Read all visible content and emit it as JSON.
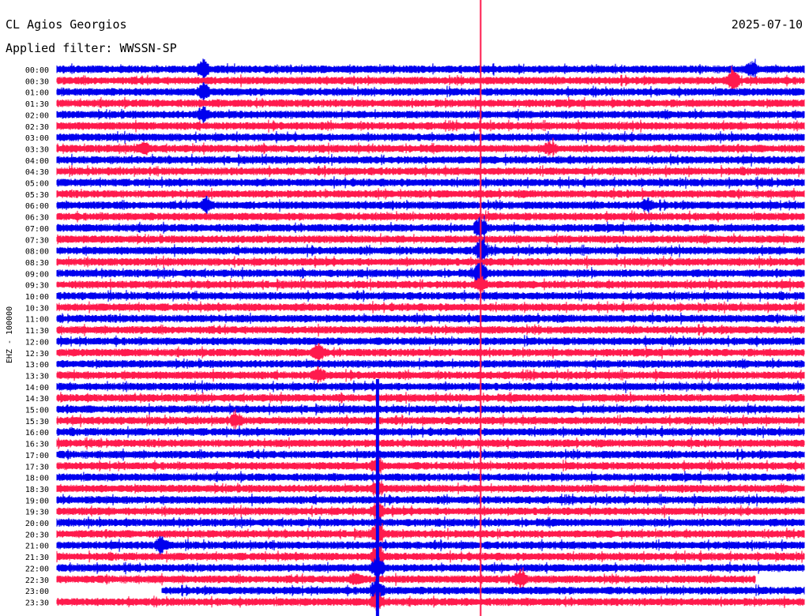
{
  "header": {
    "station": "CL Agios Georgios",
    "date": "2025-07-10",
    "filter": "Applied filter: WWSSN-SP"
  },
  "chart_data": {
    "type": "line",
    "title": "CL Agios Georgios",
    "ylabel": "EHZ - 100000",
    "row_labels": [
      "00:00",
      "00:30",
      "01:00",
      "01:30",
      "02:00",
      "02:30",
      "03:00",
      "03:30",
      "04:00",
      "04:30",
      "05:00",
      "05:30",
      "06:00",
      "06:30",
      "07:00",
      "07:30",
      "08:00",
      "08:30",
      "09:00",
      "09:30",
      "10:00",
      "10:30",
      "11:00",
      "11:30",
      "12:00",
      "12:30",
      "13:00",
      "13:30",
      "14:00",
      "14:30",
      "15:00",
      "15:30",
      "16:00",
      "16:30",
      "17:00",
      "17:30",
      "18:00",
      "18:30",
      "19:00",
      "19:30",
      "20:00",
      "20:30",
      "21:00",
      "21:30",
      "22:00",
      "22:30",
      "23:00",
      "23:30"
    ],
    "colors": [
      "#0000ee",
      "#ff1a4d"
    ],
    "event_lines": [
      {
        "color": "#ff1a4d",
        "x_fraction": 0.567
      },
      {
        "color": "#0000ee",
        "x_fraction": 0.429
      }
    ],
    "events": [
      {
        "row": 0,
        "pos": 0.196,
        "amp": 1.8,
        "color": "#0000ee"
      },
      {
        "row": 0,
        "pos": 0.93,
        "amp": 1.2,
        "color": "#0000ee"
      },
      {
        "row": 1,
        "pos": 0.905,
        "amp": 2.0,
        "color": "#ff1a4d"
      },
      {
        "row": 2,
        "pos": 0.196,
        "amp": 1.6,
        "color": "#0000ee"
      },
      {
        "row": 4,
        "pos": 0.196,
        "amp": 1.4,
        "color": "#0000ee"
      },
      {
        "row": 7,
        "pos": 0.115,
        "amp": 1.3,
        "color": "#0000ee"
      },
      {
        "row": 7,
        "pos": 0.66,
        "amp": 1.1,
        "color": "#0000ee"
      },
      {
        "row": 12,
        "pos": 0.2,
        "amp": 1.5,
        "color": "#ff1a4d"
      },
      {
        "row": 12,
        "pos": 0.79,
        "amp": 1.2,
        "color": "#ff1a4d"
      },
      {
        "row": 14,
        "pos": 0.567,
        "amp": 2.4,
        "color": "#ff1a4d"
      },
      {
        "row": 16,
        "pos": 0.567,
        "amp": 2.6,
        "color": "#ff1a4d"
      },
      {
        "row": 18,
        "pos": 0.567,
        "amp": 2.4,
        "color": "#ff1a4d"
      },
      {
        "row": 19,
        "pos": 0.567,
        "amp": 1.6,
        "color": "#ff1a4d"
      },
      {
        "row": 25,
        "pos": 0.35,
        "amp": 1.6,
        "color": "#0000ee"
      },
      {
        "row": 27,
        "pos": 0.35,
        "amp": 1.5,
        "color": "#0000ee"
      },
      {
        "row": 31,
        "pos": 0.24,
        "amp": 1.3,
        "color": "#ff1a4d"
      },
      {
        "row": 35,
        "pos": 0.429,
        "amp": 1.8,
        "color": "#ff1a4d"
      },
      {
        "row": 37,
        "pos": 0.429,
        "amp": 1.6,
        "color": "#ff1a4d"
      },
      {
        "row": 39,
        "pos": 0.429,
        "amp": 1.8,
        "color": "#ff1a4d"
      },
      {
        "row": 41,
        "pos": 0.429,
        "amp": 2.0,
        "color": "#ff1a4d"
      },
      {
        "row": 42,
        "pos": 0.14,
        "amp": 1.6,
        "color": "#0000ee"
      },
      {
        "row": 43,
        "pos": 0.429,
        "amp": 2.2,
        "color": "#ff1a4d"
      },
      {
        "row": 44,
        "pos": 0.429,
        "amp": 2.4,
        "color": "#0000ee"
      },
      {
        "row": 45,
        "pos": 0.62,
        "amp": 1.8,
        "color": "#ff1a4d"
      },
      {
        "row": 45,
        "pos": 0.4,
        "amp": 1.2,
        "color": "#ff1a4d"
      },
      {
        "row": 46,
        "pos": 0.429,
        "amp": 2.6,
        "color": "#0000ee"
      },
      {
        "row": 47,
        "pos": 0.429,
        "amp": 2.0,
        "color": "#ff1a4d"
      }
    ],
    "gaps": [
      {
        "row": 46,
        "from": 0.0,
        "to": 0.14
      },
      {
        "row": 45,
        "from": 0.935,
        "to": 1.0
      }
    ]
  }
}
